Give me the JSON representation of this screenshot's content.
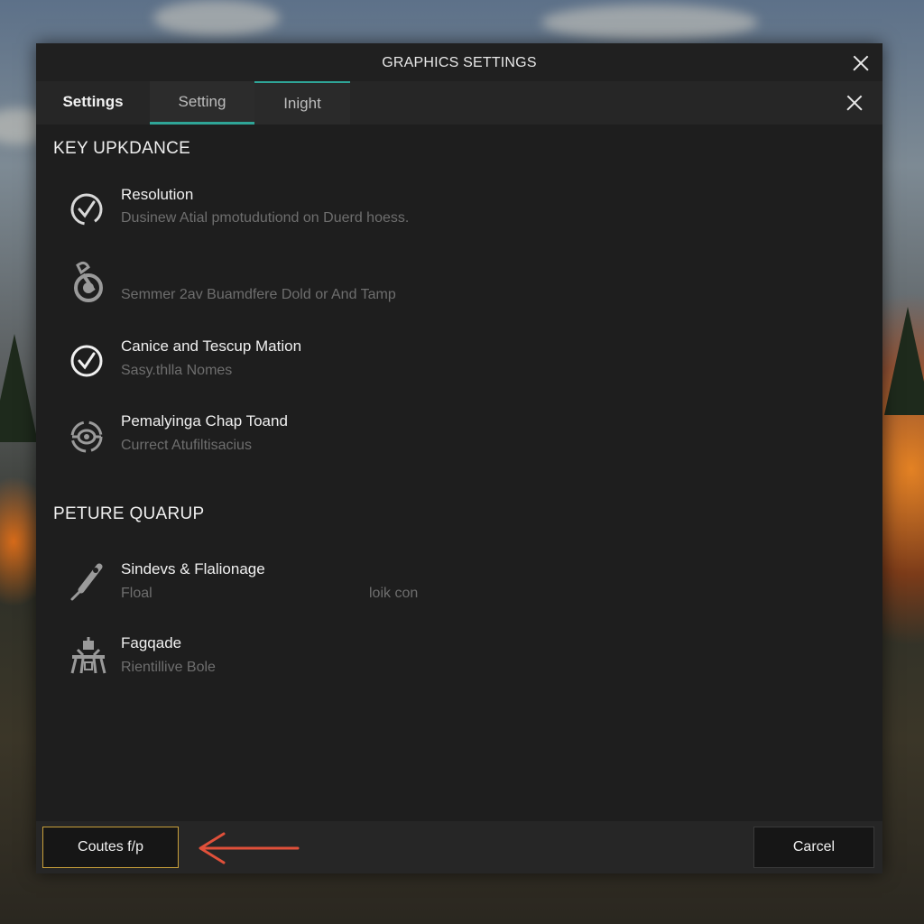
{
  "dialog": {
    "title": "GRAPHICS SETTINGS",
    "tabs": [
      "Settings",
      "Setting",
      "Inight"
    ]
  },
  "sections": [
    {
      "title": "KEY UPKDANCE",
      "items": [
        {
          "icon": "check-circle-icon",
          "title": "Resolution",
          "subtitle": "Dusinew Atial pmotudutiond on Duerd hoess."
        },
        {
          "icon": "wrench-gear-icon",
          "title": "",
          "subtitle": "Semmer 2av Buamdfere Dold or And Tamp"
        },
        {
          "icon": "check-circle-icon",
          "title": "Canice and Tescup Mation",
          "subtitle": "Sasy.thlla Nomes"
        },
        {
          "icon": "steering-wheel-icon",
          "title": "Pemalyinga Chap Toand",
          "subtitle": "Currect Atufiltisacius"
        }
      ]
    },
    {
      "title": "PETURE QUARUP",
      "items": [
        {
          "icon": "brush-icon",
          "title": "Sindevs & Flalionage",
          "subtitle": "Floal",
          "aux": "loik con"
        },
        {
          "icon": "structure-icon",
          "title": "Fagqade",
          "subtitle": "Rientillive Bole"
        }
      ]
    }
  ],
  "footer": {
    "primary_label": "Coutes f/p",
    "cancel_label": "Carcel"
  },
  "colors": {
    "accent": "#2fa597",
    "primary_border": "#c9a03a",
    "arrow": "#e0503a"
  }
}
